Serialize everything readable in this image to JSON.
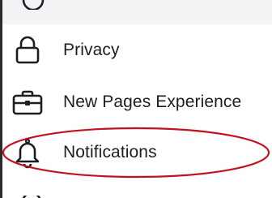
{
  "menu": {
    "items": [
      {
        "label": "Privacy",
        "icon": "lock-icon"
      },
      {
        "label": "New Pages Experience",
        "icon": "briefcase-icon"
      },
      {
        "label": "Notifications",
        "icon": "bell-icon"
      }
    ]
  },
  "colors": {
    "annotation_ellipse": "#c1121f",
    "text": "#1c1e21",
    "top_band": "#f2f3f5"
  }
}
